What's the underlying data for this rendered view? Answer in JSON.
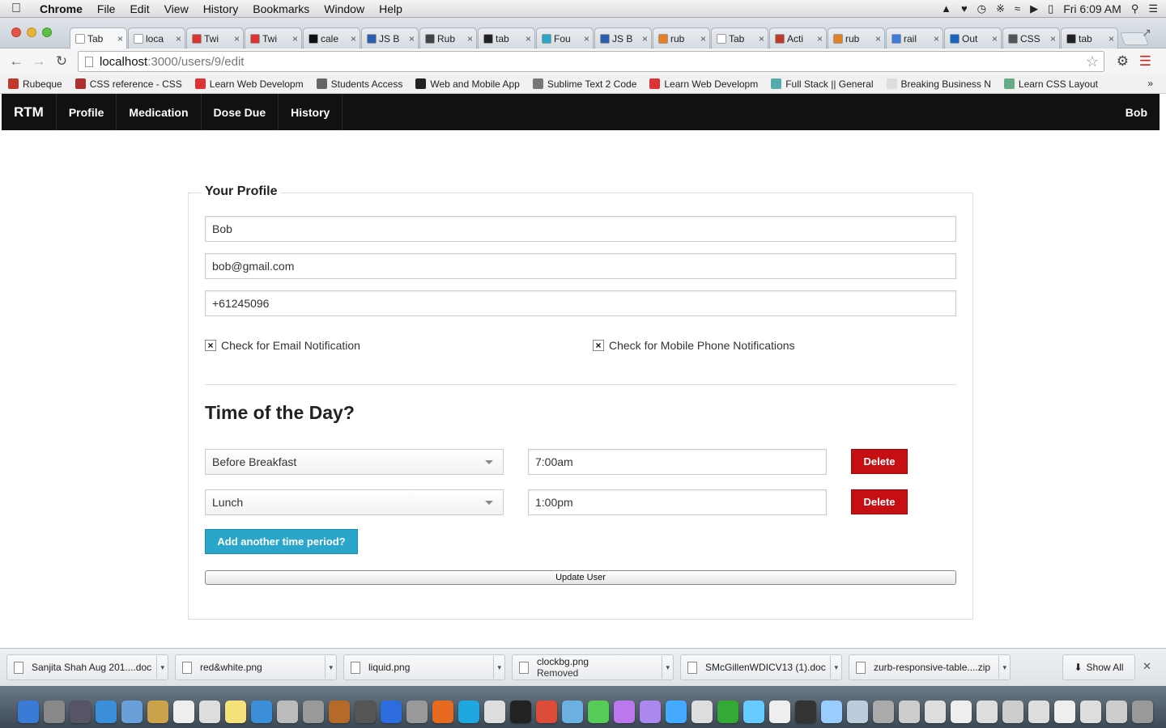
{
  "menubar": {
    "app": "Chrome",
    "items": [
      "File",
      "Edit",
      "View",
      "History",
      "Bookmarks",
      "Window",
      "Help"
    ],
    "clock": "Fri 6:09 AM"
  },
  "tabs": [
    {
      "label": "Tab",
      "color": "#ffffff"
    },
    {
      "label": "loca",
      "color": "#ffffff"
    },
    {
      "label": "Twi",
      "color": "#d33"
    },
    {
      "label": "Twi",
      "color": "#d33"
    },
    {
      "label": "cale",
      "color": "#111"
    },
    {
      "label": "JS B",
      "color": "#2a5db0"
    },
    {
      "label": "Rub",
      "color": "#444"
    },
    {
      "label": "tab",
      "color": "#222"
    },
    {
      "label": "Fou",
      "color": "#2ba6cb"
    },
    {
      "label": "JS B",
      "color": "#2a5db0"
    },
    {
      "label": "rub",
      "color": "#e67e22"
    },
    {
      "label": "Tab",
      "color": "#ffffff"
    },
    {
      "label": "Acti",
      "color": "#c0392b"
    },
    {
      "label": "rub",
      "color": "#e67e22"
    },
    {
      "label": "rail",
      "color": "#3b7ddd"
    },
    {
      "label": "Out",
      "color": "#1565c0"
    },
    {
      "label": "CSS",
      "color": "#555"
    },
    {
      "label": "tab",
      "color": "#222"
    }
  ],
  "address": {
    "host": "localhost",
    "path": ":3000/users/9/edit"
  },
  "bookmarks": [
    {
      "label": "Rubeque",
      "color": "#c0392b"
    },
    {
      "label": "CSS reference - CSS",
      "color": "#b03030"
    },
    {
      "label": "Learn Web Developm",
      "color": "#d33"
    },
    {
      "label": "Students Access",
      "color": "#666"
    },
    {
      "label": "Web and Mobile App",
      "color": "#222"
    },
    {
      "label": "Sublime Text 2 Code",
      "color": "#777"
    },
    {
      "label": "Learn Web Developm",
      "color": "#d33"
    },
    {
      "label": "Full Stack || General",
      "color": "#5aa"
    },
    {
      "label": "Breaking Business N",
      "color": "#ddd"
    },
    {
      "label": "Learn CSS Layout",
      "color": "#6a8"
    }
  ],
  "nav": {
    "brand": "RTM",
    "items": [
      "Profile",
      "Medication",
      "Dose Due",
      "History"
    ],
    "user": "Bob"
  },
  "profile": {
    "legend": "Your Profile",
    "name": "Bob",
    "email": "bob@gmail.com",
    "phone": "+61245096",
    "email_notify_label": "Check for Email Notification",
    "email_notify_checked": true,
    "mobile_notify_label": "Check for Mobile Phone Notifications",
    "mobile_notify_checked": true,
    "check_mark": "×"
  },
  "times": {
    "heading": "Time of the Day?",
    "rows": [
      {
        "period": "Before Breakfast",
        "time": "7:00am",
        "delete_label": "Delete"
      },
      {
        "period": "Lunch",
        "time": "1:00pm",
        "delete_label": "Delete"
      }
    ],
    "add_label": "Add another time period?",
    "update_label": "Update User"
  },
  "downloads": [
    {
      "name": "Sanjita Shah Aug 201....doc",
      "status": ""
    },
    {
      "name": "red&white.png",
      "status": ""
    },
    {
      "name": "liquid.png",
      "status": ""
    },
    {
      "name": "clockbg.png",
      "status": "Removed"
    },
    {
      "name": "SMcGillenWDICV13 (1).doc",
      "status": ""
    },
    {
      "name": "zurb-responsive-table....zip",
      "status": ""
    }
  ],
  "show_all_label": "Show All",
  "colors": {
    "navbar": "#111111",
    "delete": "#c60f13",
    "add": "#2ba6cb"
  },
  "dock_colors": [
    "#3a7bd5",
    "#888",
    "#556",
    "#3b8fd8",
    "#6aa0d8",
    "#c9a24a",
    "#eee",
    "#ddd",
    "#f5e27a",
    "#3a8fd8",
    "#bbb",
    "#999",
    "#b56a2a",
    "#555",
    "#2d6cdf",
    "#999",
    "#e66a1f",
    "#1fa8e0",
    "#ddd",
    "#222",
    "#dd4b39",
    "#6ab0e0",
    "#5c5",
    "#b7e",
    "#a8e",
    "#4af",
    "#ddd",
    "#3a3",
    "#6cf",
    "#eee",
    "#333",
    "#9cf",
    "#bcd",
    "#aaa",
    "#ccc",
    "#ddd",
    "#eee",
    "#ddd",
    "#ccc",
    "#ddd",
    "#eee",
    "#ddd",
    "#ccc",
    "#999"
  ]
}
